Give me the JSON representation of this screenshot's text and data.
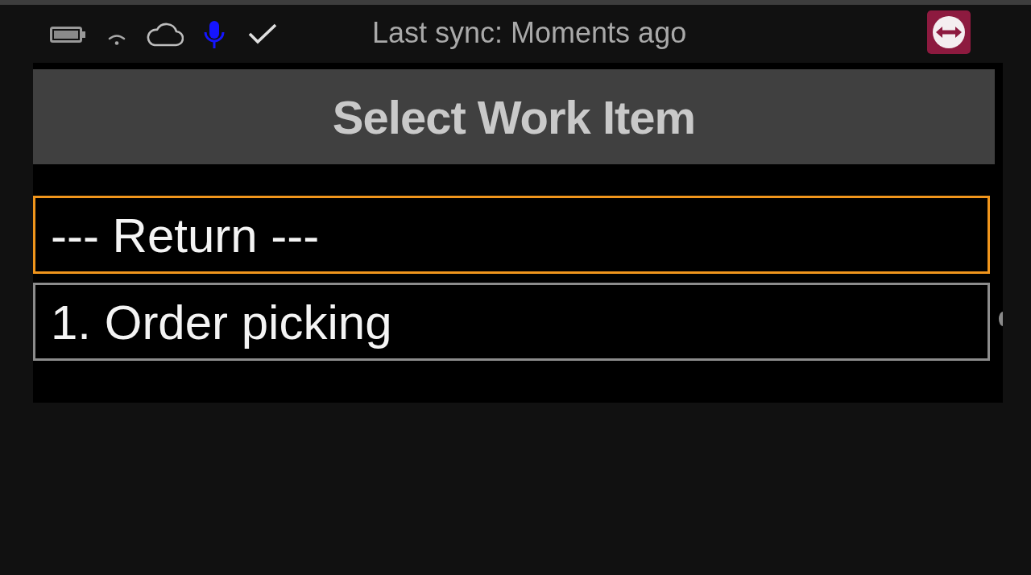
{
  "status_bar": {
    "sync_text": "Last sync: Moments ago"
  },
  "screen": {
    "title": "Select Work Item",
    "items": [
      {
        "label": "--- Return ---",
        "selected": true
      },
      {
        "label": "1. Order picking",
        "selected": false
      }
    ]
  }
}
